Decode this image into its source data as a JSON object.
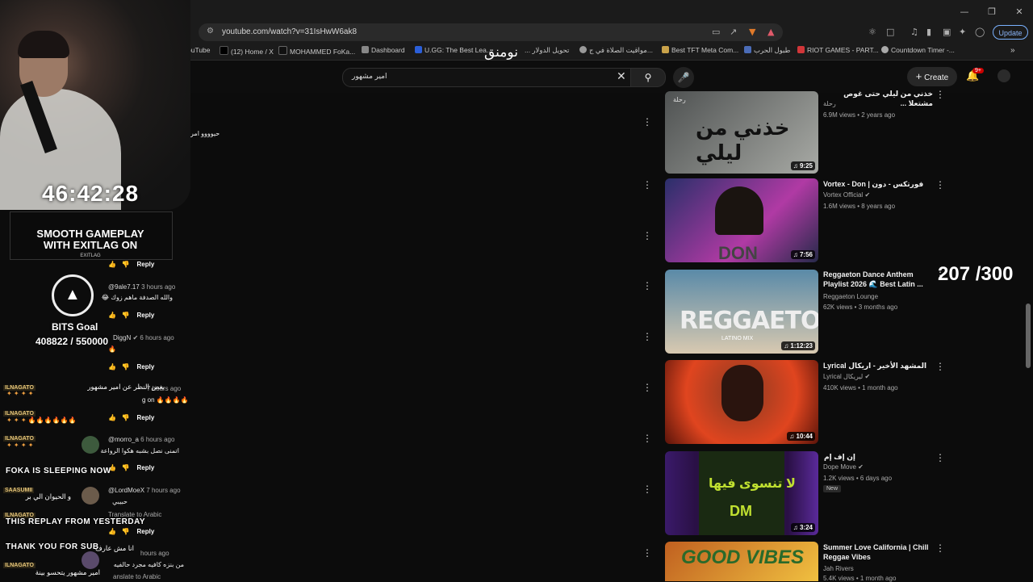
{
  "browser": {
    "url": "youtube.com/watch?v=31IsHwW6ak8",
    "update_label": "Update",
    "bookmarks": [
      "ouTube",
      "(12) Home / X",
      "MOHAMMED FoKa...",
      "Dashboard",
      "U.GG: The Best Lea...",
      "تحويل الدولار ...",
      "مواقيت الصلاة في ج...",
      "Best TFT Meta Com...",
      "طبول الحرب",
      "RIOT GAMES - PART...",
      "Countdown Timer -..."
    ]
  },
  "youtube": {
    "search_value": "امير مشهور",
    "create_label": "Create",
    "notif_badge": "9+"
  },
  "overlay": {
    "arabic_text": "نومنق",
    "timer": "46:42:28",
    "exitlag_line1": "SMOOTH GAMEPLAY",
    "exitlag_line2": "WITH EXITLAG ON",
    "exitlag_logo": "EXITLAG",
    "bits_label": "BITS Goal",
    "bits_value": "408822 / 550000",
    "counter": "207 /300",
    "chat": [
      {
        "name": "ILNAGATO",
        "text": "بغض النظر عن امير مشهور"
      },
      {
        "name": "ILNAGATO",
        "text": "🔥🔥🔥🔥🔥🔥"
      },
      {
        "name": "ILNAGATO",
        "text": ""
      },
      {
        "name": "SAASUMII",
        "text": "و الحيوان الي بر"
      },
      {
        "name": "ILNAGATO",
        "text": "انا مش عارف"
      },
      {
        "name": "ILNAGATO",
        "text": "امير مشهور يتحسو بينة"
      }
    ],
    "banners": [
      "FOKA IS SLEEPING NOW",
      "THIS REPLAY FROM YESTERDAY",
      "THANK YOU FOR SUB"
    ]
  },
  "comments": [
    {
      "text": "حيوووو امر",
      "reply": "Reply"
    },
    {
      "handle": "@9ale7.17",
      "time": "3 hours ago",
      "text": "والله الصدفة ماهم زوك 😂",
      "reply": "Reply"
    },
    {
      "handle": "DiggN",
      "time": "6 hours ago",
      "text": "🔥",
      "reply": "Reply"
    },
    {
      "handle": "",
      "time": "7 hours ago",
      "text": "g on 🔥🔥🔥🔥",
      "reply": "Reply"
    },
    {
      "handle": "@morro_a",
      "time": "6 hours ago",
      "text": "اتمنى نصل بشبه هكوا الرواعة",
      "reply": "Reply"
    },
    {
      "handle": "@LordMoeX",
      "time": "7 hours ago",
      "text": "حبيبي",
      "translate": "Translate to Arabic",
      "reply": "Reply"
    },
    {
      "handle": "",
      "time": "hours ago",
      "text": "من بنزه كافيه مجرد حالفيه",
      "translate": "anslate to Arabic"
    }
  ],
  "recommendations": [
    {
      "title": "خذني من ليلي حتى غوص مشتعلا ...",
      "channel": "رحلة",
      "meta": "6.9M views • 2 years ago",
      "duration": "9:25",
      "thumb_text": "خذني من ليلي",
      "thumb_tag": "رحلة",
      "colors": [
        "#5b5e5e",
        "#a5a7a2"
      ]
    },
    {
      "title": "Vortex - Don | فورتكس - دون",
      "channel": "Vortex Official",
      "meta": "1.6M views • 8 years ago",
      "duration": "7:56",
      "thumb_text": "DON",
      "colors": [
        "#3a2c6a",
        "#b03aa4"
      ]
    },
    {
      "title": "Reggaeton Dance Anthem Playlist 2026 🌊 Best Latin ...",
      "channel": "Reggaeton Lounge",
      "meta": "62K views • 3 months ago",
      "duration": "1:12:23",
      "thumb_text": "REGGAETON",
      "thumb_sub": "LATINO MIX",
      "colors": [
        "#6a8aa0",
        "#d8c9b0"
      ]
    },
    {
      "title": "Lyrical المشهد الأخير - اريكال",
      "channel": "Lyrical ليريكال",
      "meta": "410K views • 1 month ago",
      "duration": "10:44",
      "colors": [
        "#6a1d12",
        "#e0451f"
      ]
    },
    {
      "title": "إن إف إم",
      "channel": "Dope Move",
      "meta": "1.2K views • 6 days ago",
      "badge": "New",
      "duration": "3:24",
      "thumb_text": "لا تنسوى فيها",
      "thumb_sub": "DM",
      "colors": [
        "#2a0f4a",
        "#6a2fa0"
      ]
    },
    {
      "title": "Summer Love California | Chill Reggae Vibes",
      "channel": "Jah Rivers",
      "meta": "5.4K views • 1 month ago",
      "thumb_text": "GOOD VIBES",
      "colors": [
        "#c06020",
        "#f0c040"
      ]
    }
  ]
}
